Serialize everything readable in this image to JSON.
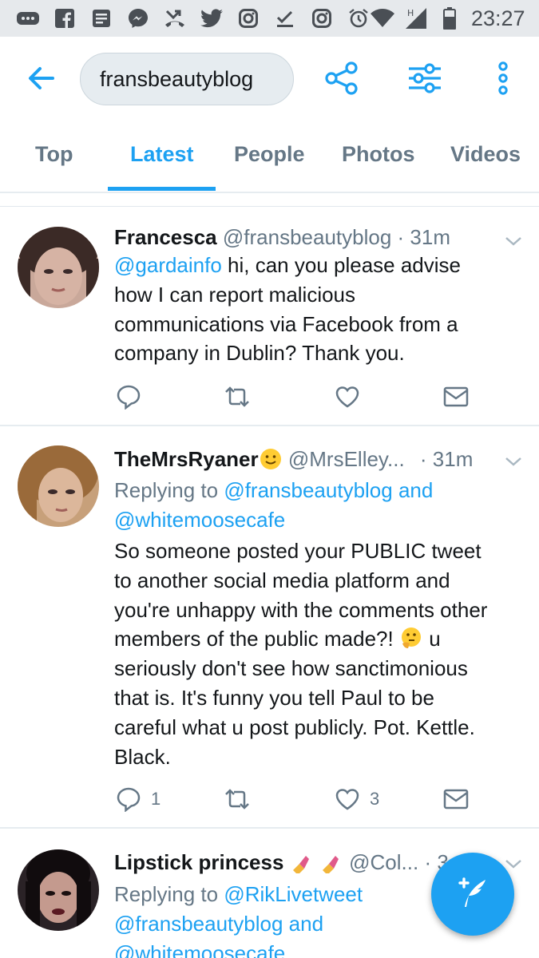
{
  "status_bar": {
    "time": "23:27",
    "icons": [
      "more-icon",
      "facebook-icon",
      "news-icon",
      "messenger-icon",
      "missed-call-icon",
      "twitter-icon",
      "instagram-icon",
      "check-icon",
      "instagram-icon",
      "alarm-icon",
      "wifi-icon",
      "signal-icon",
      "battery-icon"
    ]
  },
  "search": {
    "query": "fransbeautyblog"
  },
  "toolbar": {
    "icons": [
      "back-arrow-icon",
      "share-icon",
      "filter-icon",
      "more-vertical-icon"
    ]
  },
  "tabs": [
    "Top",
    "Latest",
    "People",
    "Photos",
    "Videos"
  ],
  "active_tab": "Latest",
  "tweets": [
    {
      "name": "Francesca",
      "handle": "@fransbeautyblog",
      "time": "· 31m",
      "mention": "@gardainfo",
      "body_lines": [
        " hi, can you please advise",
        "how I can report malicious",
        "communications via Facebook from a",
        "company in Dublin? Thank you."
      ],
      "reply_count": "",
      "like_count": ""
    },
    {
      "name": "TheMrsRyaner",
      "handle": "@MrsElley...",
      "time": "· 31m",
      "replying_prefix": "Replying to ",
      "replying_to_1": "@fransbeautyblog",
      "replying_and": " and",
      "replying_to_2": "@whitemoosecafe",
      "body_lines": [
        "So someone posted your PUBLIC tweet",
        "to another social media platform and",
        "you're unhappy with the comments other",
        "members of the public made?!",
        "seriously don't see how sanctimonious",
        "that is. It's funny you tell Paul to be",
        "careful what u post publicly. Pot. Kettle.",
        "Black."
      ],
      "line4_suffix": " u",
      "reply_count": "1",
      "like_count": "3"
    },
    {
      "name": "Lipstick princess",
      "handle": "@Col...",
      "time": "· 3",
      "replying_prefix": "Replying to ",
      "replying_to_1": "@RikLivetweet",
      "replying_to_2": "@fransbeautyblog",
      "replying_and": " and",
      "replying_to_3": "@whitemoosecafe"
    }
  ],
  "colors": {
    "accent": "#1da1f2",
    "muted": "#657786",
    "text": "#14171a",
    "divider": "#e6ecf0"
  }
}
